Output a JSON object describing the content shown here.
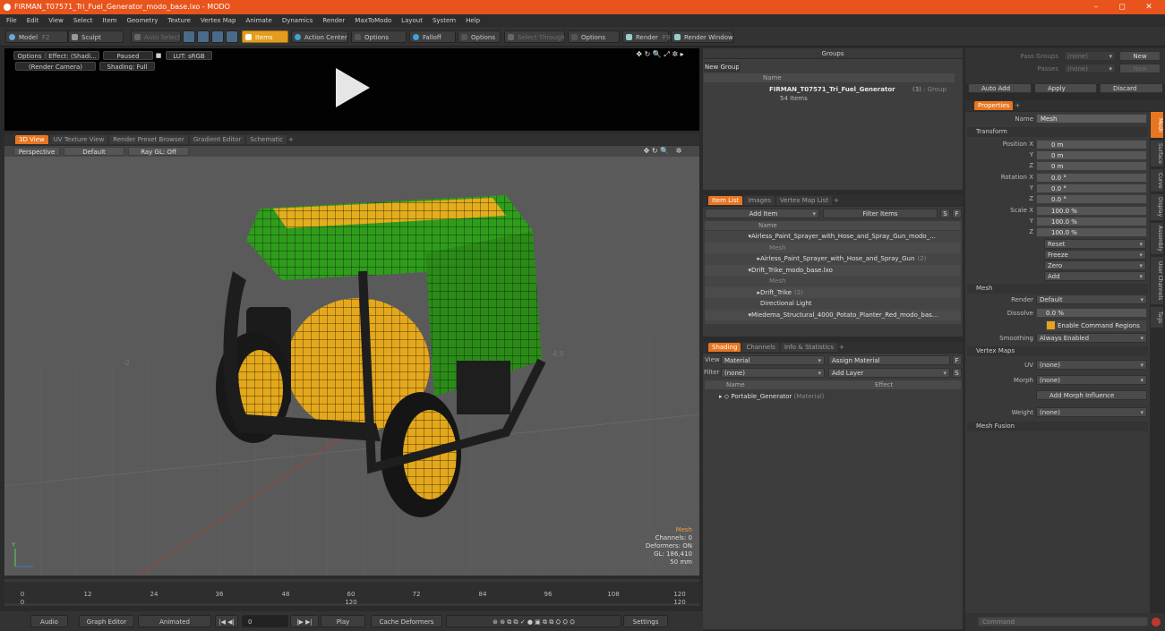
{
  "window": {
    "title": "FIRMAN_T07571_Tri_Fuel_Generator_modo_base.lxo - MODO",
    "controls": [
      "–",
      "◻",
      "✕"
    ]
  },
  "menu": [
    "File",
    "Edit",
    "View",
    "Select",
    "Item",
    "Geometry",
    "Texture",
    "Vertex Map",
    "Animate",
    "Dynamics",
    "Render",
    "MaxToModo",
    "Layout",
    "System",
    "Help"
  ],
  "toolbar": {
    "model": "Model",
    "model_key": "F2",
    "sculpt": "Sculpt",
    "auto_select": "Auto Select",
    "items": "Items",
    "action_center": "Action Center",
    "options1": "Options",
    "falloff": "Falloff",
    "options2": "Options",
    "select_through": "Select Through",
    "options3": "Options",
    "render": "Render",
    "render_key": "F9",
    "render_window": "Render Window"
  },
  "preview": {
    "options": "Options",
    "effect": "Effect: (Shadi...",
    "paused": "Paused",
    "lut": "LUT: sRGB",
    "camera": "(Render Camera)",
    "shading": "Shading: Full"
  },
  "view_tabs": [
    "3D View",
    "UV Texture View",
    "Render Preset Browser",
    "Gradient Editor",
    "Schematic",
    "+"
  ],
  "viewport": {
    "perspective": "Perspective",
    "default": "Default",
    "raygl": "Ray GL: Off",
    "hud": {
      "title": "Mesh",
      "channels": "Channels: 0",
      "deformers": "Deformers: ON",
      "gl": "GL: 186,410",
      "size": "50 mm"
    }
  },
  "timeline": {
    "ticks": [
      "0",
      "12",
      "24",
      "36",
      "48",
      "60",
      "72",
      "84",
      "96",
      "108",
      "120"
    ],
    "start": "0",
    "mid": "120",
    "end": "120"
  },
  "bottombar": {
    "audio": "Audio",
    "graph_editor": "Graph Editor",
    "animated": "Animated",
    "frame": "0",
    "play": "Play",
    "cache": "Cache Deformers",
    "settings": "Settings"
  },
  "groups": {
    "title": "Groups",
    "new_group": "New Group",
    "col_name": "Name",
    "item_name": "FIRMAN_T07571_Tri_Fuel_Generator",
    "item_count": "(3)",
    "item_type": ": Group",
    "item_sub": "54 Items"
  },
  "item_list": {
    "tabs": [
      "Item List",
      "Images",
      "Vertex Map List",
      "+"
    ],
    "add_item": "Add Item",
    "filter": "Filter Items",
    "col_name": "Name",
    "rows": [
      {
        "label": "Airless_Paint_Sprayer_with_Hose_and_Spray_Gun_modo_...",
        "indent": 0,
        "kind": "scene"
      },
      {
        "label": "Mesh",
        "indent": 2,
        "kind": "mesh-dim"
      },
      {
        "label": "Airless_Paint_Sprayer_with_Hose_and_Spray_Gun",
        "suffix": "(2)",
        "indent": 1,
        "kind": "group"
      },
      {
        "label": "Drift_Trike_modo_base.lxo",
        "indent": 0,
        "kind": "scene"
      },
      {
        "label": "Mesh",
        "indent": 2,
        "kind": "mesh-dim"
      },
      {
        "label": "Drift_Trike",
        "suffix": "(2)",
        "indent": 1,
        "kind": "group"
      },
      {
        "label": "Directional Light",
        "indent": 1,
        "kind": "light"
      },
      {
        "label": "Miedema_Structural_4000_Potato_Planter_Red_modo_bas...",
        "indent": 0,
        "kind": "scene"
      }
    ]
  },
  "shading": {
    "tabs": [
      "Shading",
      "Channels",
      "Info & Statistics",
      "+"
    ],
    "view_label": "View",
    "view_value": "Material",
    "assign": "Assign Material",
    "filter_label": "Filter",
    "filter_value": "(none)",
    "add_layer": "Add Layer",
    "col_name": "Name",
    "col_effect": "Effect",
    "row_name": "Portable_Generator",
    "row_type": "(Material)"
  },
  "right": {
    "pass_groups_label": "Pass Groups",
    "pass_groups_value": "(none)",
    "passes_label": "Passes",
    "passes_value": "(none)",
    "new": "New",
    "auto_add": "Auto Add",
    "apply": "Apply",
    "discard": "Discard",
    "properties_tab": "Properties",
    "name_label": "Name",
    "name_value": "Mesh",
    "transform": "Transform",
    "position": [
      {
        "axis": "Position X",
        "v": "0 m"
      },
      {
        "axis": "Y",
        "v": "0 m"
      },
      {
        "axis": "Z",
        "v": "0 m"
      }
    ],
    "rotation": [
      {
        "axis": "Rotation X",
        "v": "0.0 °"
      },
      {
        "axis": "Y",
        "v": "0.0 °"
      },
      {
        "axis": "Z",
        "v": "0.0 °"
      }
    ],
    "scale": [
      {
        "axis": "Scale X",
        "v": "100.0 %"
      },
      {
        "axis": "Y",
        "v": "100.0 %"
      },
      {
        "axis": "Z",
        "v": "100.0 %"
      }
    ],
    "reset": "Reset",
    "freeze": "Freeze",
    "zero": "Zero",
    "add": "Add",
    "mesh": "Mesh",
    "render_label": "Render",
    "render_value": "Default",
    "dissolve_label": "Dissolve",
    "dissolve_value": "0.0 %",
    "enable_cmd": "Enable Command Regions",
    "smoothing_label": "Smoothing",
    "smoothing_value": "Always Enabled",
    "vertex_maps": "Vertex Maps",
    "uv_label": "UV",
    "uv_value": "(none)",
    "morph_label": "Morph",
    "morph_value": "(none)",
    "add_morph": "Add Morph Influence",
    "weight_label": "Weight",
    "weight_value": "(none)",
    "mesh_fusion": "Mesh Fusion",
    "side_tabs": [
      "Mesh",
      "Surface",
      "Curve",
      "Display",
      "Assembly",
      "User Channels",
      "Tags"
    ],
    "command": "Command"
  }
}
